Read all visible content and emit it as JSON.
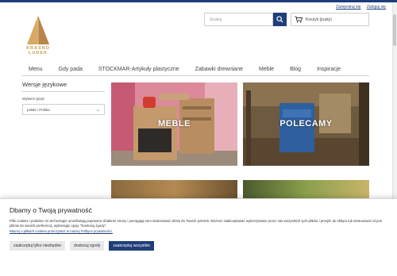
{
  "header": {
    "account_links": [
      "Zarejestruj się",
      "Zaloguj się"
    ],
    "logo_text_line1": "KRASNO",
    "logo_text_line2": "LUDEK",
    "search_placeholder": "Szukaj",
    "cart_label": "Koszyk (pusty)"
  },
  "nav": {
    "items": [
      "Menu",
      "Gdy pada",
      "STOCKMAR-Artykuły plastyczne",
      "Zabawki drewniane",
      "Meble",
      "Blog",
      "Inspiracje"
    ]
  },
  "sidebar": {
    "title": "Wersje językowe",
    "label": "Wybierz język",
    "selected": "polski / Polska"
  },
  "tiles": [
    {
      "label": "MEBLE"
    },
    {
      "label": "POLECAMY"
    }
  ],
  "cookie": {
    "title": "Dbamy o Twoją prywatność",
    "text": "Pliki cookies i podobne im technologie umożliwiają poprawne działanie strony i pomagają nam dostosować ofertę do Twoich potrzeb. Możesz zaakceptować wykorzystanie przez nas wszystkich tych plików i przejść do sklepu lub dostosować użycie plików do swoich preferencji, wybierając opcję \"Dostosuj zgody\".",
    "link": "Więcej o plikach cookies przeczytasz w naszej Polityce prywatności.",
    "buttons": [
      "zaakceptuj tylko niezbędne",
      "dostosuj zgody",
      "zaakceptuj wszystkie"
    ]
  },
  "colors": {
    "accent": "#1f3d7a",
    "logo": "#c99a55"
  }
}
